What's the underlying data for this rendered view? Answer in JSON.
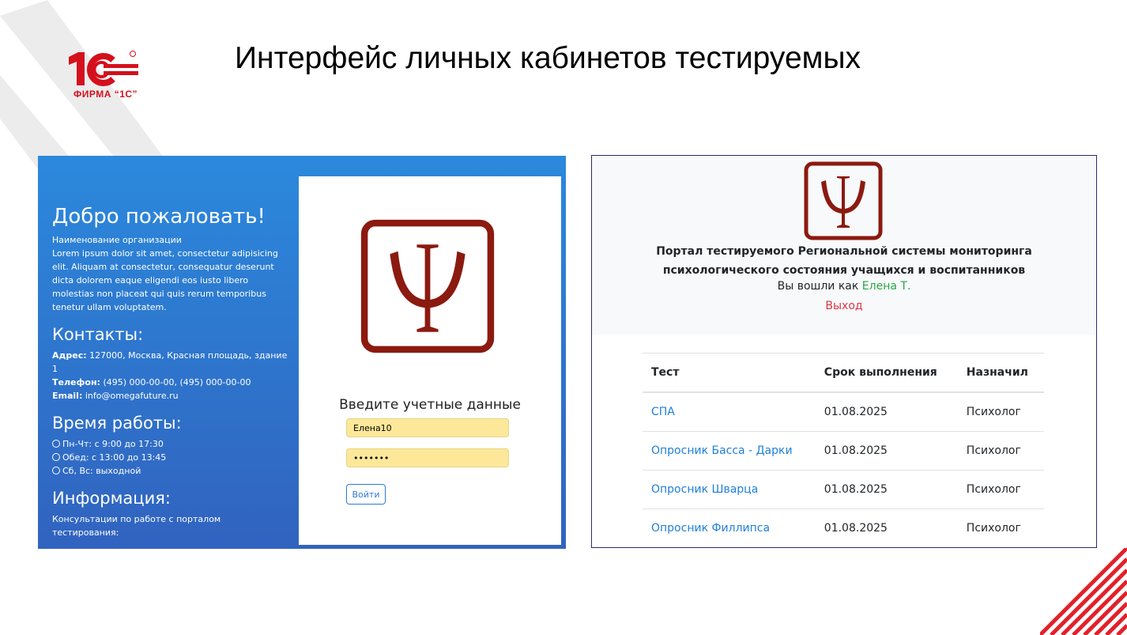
{
  "slide": {
    "title": "Интерфейс личных кабинетов тестируемых",
    "brand_caption": "ФИРМА “1С”"
  },
  "login_screen": {
    "welcome": {
      "heading": "Добро пожаловать!",
      "org_name": "Наименование организации",
      "lorem": "Lorem ipsum dolor sit amet, consectetur adipisicing elit. Aliquam at consectetur, consequatur deserunt dicta dolorem eaque eligendi eos iusto libero molestias non placeat qui quis rerum temporibus tenetur ullam voluptatem."
    },
    "contacts": {
      "heading": "Контакты:",
      "address_label": "Адрес:",
      "address": "127000, Москва, Красная площадь, здание 1",
      "phone_label": "Телефон:",
      "phone": "(495) 000-00-00, (495) 000-00-00",
      "email_label": "Email:",
      "email": "info@omegafuture.ru"
    },
    "hours": {
      "heading": "Время работы:",
      "items": [
        "Пн-Чт: с 9:00 до 17:30",
        "Обед: с 13:00 до 13:45",
        "Сб, Вс: выходной"
      ]
    },
    "information": {
      "heading": "Информация:",
      "text": "Консультации по работе с порталом тестирования:"
    },
    "form": {
      "title": "Введите учетные данные",
      "login_value": "Елена10",
      "password_value": "•••••••",
      "submit_label": "Войти"
    }
  },
  "portal_screen": {
    "title": "Портал тестируемого Региональной системы мониторинга психологического состояния учащихся и воспитанников",
    "logged_in_prefix": "Вы вошли как",
    "user_name": "Елена Т.",
    "logout_label": "Выход",
    "table": {
      "headers": [
        "Тест",
        "Срок выполнения",
        "Назначил"
      ],
      "rows": [
        [
          "СПА",
          "01.08.2025",
          "Психолог"
        ],
        [
          "Опросник Басса - Дарки",
          "01.08.2025",
          "Психолог"
        ],
        [
          "Опросник Шварца",
          "01.08.2025",
          "Психолог"
        ],
        [
          "Опросник Филлипса",
          "01.08.2025",
          "Психолог"
        ]
      ]
    }
  },
  "colors": {
    "brand_red": "#d4101c",
    "psy_logo": "#8b1a10",
    "link_blue": "#1e7fd8",
    "success_green": "#28a745",
    "danger_red": "#dc3545"
  }
}
